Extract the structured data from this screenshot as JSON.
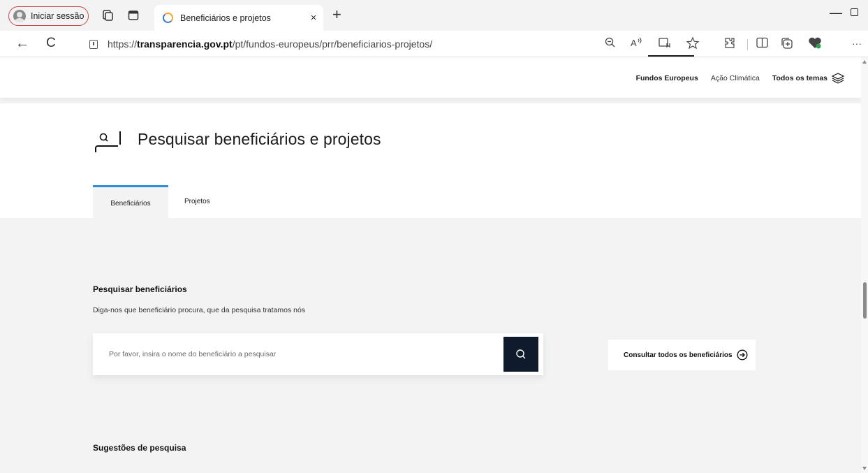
{
  "browser": {
    "profile_label": "Iniciar sessão",
    "tab_title": "Beneficiários e projetos",
    "tab_close": "×",
    "new_tab": "+",
    "minimize": "—",
    "back": "←",
    "refresh": "C",
    "url_prefix": "https://",
    "url_host": "transparencia.gov.pt",
    "url_path": "/pt/fundos-europeus/prr/beneficiarios-projetos/",
    "more": "···"
  },
  "site_nav": {
    "items": [
      "Fundos Europeus",
      "Ação Climática",
      "Todos os temas"
    ]
  },
  "page": {
    "title": "Pesquisar beneficiários e projetos",
    "tabs": [
      "Beneficiários",
      "Projetos"
    ],
    "active_tab": "Beneficiários"
  },
  "search": {
    "title": "Pesquisar beneficiários",
    "subtitle": "Diga-nos que beneficiário procura, que da pesquisa tratamos nós",
    "placeholder": "Por favor, insira o nome do beneficiário a pesquisar",
    "consult_all": "Consultar todos os beneficiários"
  },
  "suggestions": {
    "title": "Sugestões de pesquisa"
  },
  "colors": {
    "accent_tab": "#2f8fd6",
    "search_button": "#0f1b2d",
    "profile_border": "#c94b4b"
  }
}
